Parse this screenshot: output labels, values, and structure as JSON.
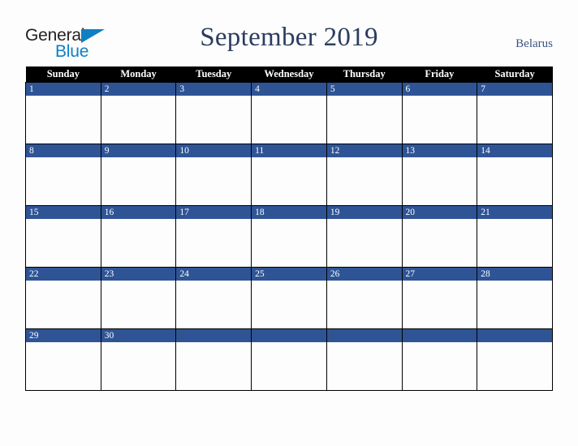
{
  "brand": {
    "name_part1": "General",
    "name_part2": "Blue",
    "triangle_icon": "triangle-icon",
    "accent_color": "#0f7fc4",
    "text_color": "#231f20"
  },
  "header": {
    "title": "September 2019",
    "month": "September",
    "year": "2019",
    "country": "Belarus",
    "title_color": "#2b3c60",
    "country_color": "#3c5480"
  },
  "calendar": {
    "weekday_headers": [
      "Sunday",
      "Monday",
      "Tuesday",
      "Wednesday",
      "Thursday",
      "Friday",
      "Saturday"
    ],
    "header_bg": "#000000",
    "header_text_color": "#ffffff",
    "day_band_color": "#2f5496",
    "day_number_color": "#ffffff",
    "cell_bg": "#fdfdfd",
    "border_color": "#000000",
    "weeks": [
      [
        {
          "day": "1"
        },
        {
          "day": "2"
        },
        {
          "day": "3"
        },
        {
          "day": "4"
        },
        {
          "day": "5"
        },
        {
          "day": "6"
        },
        {
          "day": "7"
        }
      ],
      [
        {
          "day": "8"
        },
        {
          "day": "9"
        },
        {
          "day": "10"
        },
        {
          "day": "11"
        },
        {
          "day": "12"
        },
        {
          "day": "13"
        },
        {
          "day": "14"
        }
      ],
      [
        {
          "day": "15"
        },
        {
          "day": "16"
        },
        {
          "day": "17"
        },
        {
          "day": "18"
        },
        {
          "day": "19"
        },
        {
          "day": "20"
        },
        {
          "day": "21"
        }
      ],
      [
        {
          "day": "22"
        },
        {
          "day": "23"
        },
        {
          "day": "24"
        },
        {
          "day": "25"
        },
        {
          "day": "26"
        },
        {
          "day": "27"
        },
        {
          "day": "28"
        }
      ],
      [
        {
          "day": "29"
        },
        {
          "day": "30"
        },
        {
          "day": ""
        },
        {
          "day": ""
        },
        {
          "day": ""
        },
        {
          "day": ""
        },
        {
          "day": ""
        }
      ]
    ]
  }
}
